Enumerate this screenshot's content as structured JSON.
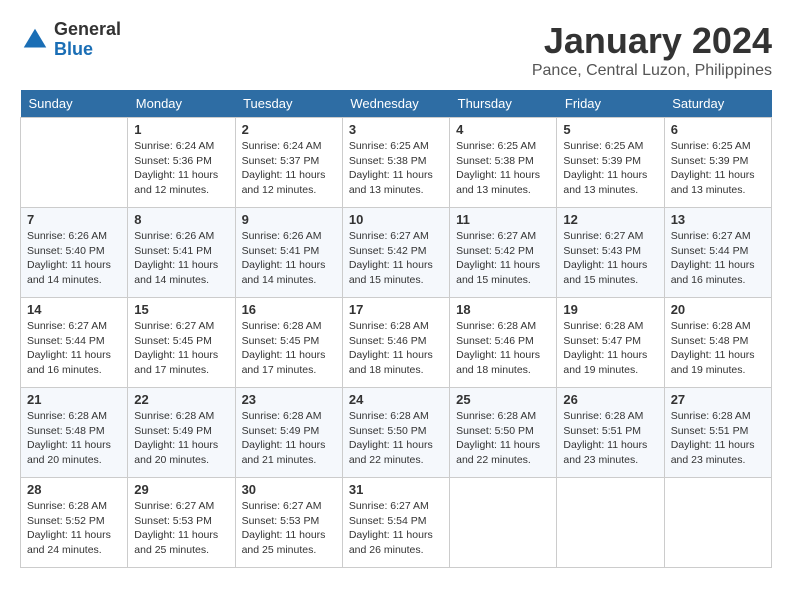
{
  "logo": {
    "general": "General",
    "blue": "Blue"
  },
  "title": "January 2024",
  "subtitle": "Pance, Central Luzon, Philippines",
  "days_of_week": [
    "Sunday",
    "Monday",
    "Tuesday",
    "Wednesday",
    "Thursday",
    "Friday",
    "Saturday"
  ],
  "weeks": [
    [
      {
        "day": "",
        "info": ""
      },
      {
        "day": "1",
        "info": "Sunrise: 6:24 AM\nSunset: 5:36 PM\nDaylight: 11 hours\nand 12 minutes."
      },
      {
        "day": "2",
        "info": "Sunrise: 6:24 AM\nSunset: 5:37 PM\nDaylight: 11 hours\nand 12 minutes."
      },
      {
        "day": "3",
        "info": "Sunrise: 6:25 AM\nSunset: 5:38 PM\nDaylight: 11 hours\nand 13 minutes."
      },
      {
        "day": "4",
        "info": "Sunrise: 6:25 AM\nSunset: 5:38 PM\nDaylight: 11 hours\nand 13 minutes."
      },
      {
        "day": "5",
        "info": "Sunrise: 6:25 AM\nSunset: 5:39 PM\nDaylight: 11 hours\nand 13 minutes."
      },
      {
        "day": "6",
        "info": "Sunrise: 6:25 AM\nSunset: 5:39 PM\nDaylight: 11 hours\nand 13 minutes."
      }
    ],
    [
      {
        "day": "7",
        "info": "Sunrise: 6:26 AM\nSunset: 5:40 PM\nDaylight: 11 hours\nand 14 minutes."
      },
      {
        "day": "8",
        "info": "Sunrise: 6:26 AM\nSunset: 5:41 PM\nDaylight: 11 hours\nand 14 minutes."
      },
      {
        "day": "9",
        "info": "Sunrise: 6:26 AM\nSunset: 5:41 PM\nDaylight: 11 hours\nand 14 minutes."
      },
      {
        "day": "10",
        "info": "Sunrise: 6:27 AM\nSunset: 5:42 PM\nDaylight: 11 hours\nand 15 minutes."
      },
      {
        "day": "11",
        "info": "Sunrise: 6:27 AM\nSunset: 5:42 PM\nDaylight: 11 hours\nand 15 minutes."
      },
      {
        "day": "12",
        "info": "Sunrise: 6:27 AM\nSunset: 5:43 PM\nDaylight: 11 hours\nand 15 minutes."
      },
      {
        "day": "13",
        "info": "Sunrise: 6:27 AM\nSunset: 5:44 PM\nDaylight: 11 hours\nand 16 minutes."
      }
    ],
    [
      {
        "day": "14",
        "info": "Sunrise: 6:27 AM\nSunset: 5:44 PM\nDaylight: 11 hours\nand 16 minutes."
      },
      {
        "day": "15",
        "info": "Sunrise: 6:27 AM\nSunset: 5:45 PM\nDaylight: 11 hours\nand 17 minutes."
      },
      {
        "day": "16",
        "info": "Sunrise: 6:28 AM\nSunset: 5:45 PM\nDaylight: 11 hours\nand 17 minutes."
      },
      {
        "day": "17",
        "info": "Sunrise: 6:28 AM\nSunset: 5:46 PM\nDaylight: 11 hours\nand 18 minutes."
      },
      {
        "day": "18",
        "info": "Sunrise: 6:28 AM\nSunset: 5:46 PM\nDaylight: 11 hours\nand 18 minutes."
      },
      {
        "day": "19",
        "info": "Sunrise: 6:28 AM\nSunset: 5:47 PM\nDaylight: 11 hours\nand 19 minutes."
      },
      {
        "day": "20",
        "info": "Sunrise: 6:28 AM\nSunset: 5:48 PM\nDaylight: 11 hours\nand 19 minutes."
      }
    ],
    [
      {
        "day": "21",
        "info": "Sunrise: 6:28 AM\nSunset: 5:48 PM\nDaylight: 11 hours\nand 20 minutes."
      },
      {
        "day": "22",
        "info": "Sunrise: 6:28 AM\nSunset: 5:49 PM\nDaylight: 11 hours\nand 20 minutes."
      },
      {
        "day": "23",
        "info": "Sunrise: 6:28 AM\nSunset: 5:49 PM\nDaylight: 11 hours\nand 21 minutes."
      },
      {
        "day": "24",
        "info": "Sunrise: 6:28 AM\nSunset: 5:50 PM\nDaylight: 11 hours\nand 22 minutes."
      },
      {
        "day": "25",
        "info": "Sunrise: 6:28 AM\nSunset: 5:50 PM\nDaylight: 11 hours\nand 22 minutes."
      },
      {
        "day": "26",
        "info": "Sunrise: 6:28 AM\nSunset: 5:51 PM\nDaylight: 11 hours\nand 23 minutes."
      },
      {
        "day": "27",
        "info": "Sunrise: 6:28 AM\nSunset: 5:51 PM\nDaylight: 11 hours\nand 23 minutes."
      }
    ],
    [
      {
        "day": "28",
        "info": "Sunrise: 6:28 AM\nSunset: 5:52 PM\nDaylight: 11 hours\nand 24 minutes."
      },
      {
        "day": "29",
        "info": "Sunrise: 6:27 AM\nSunset: 5:53 PM\nDaylight: 11 hours\nand 25 minutes."
      },
      {
        "day": "30",
        "info": "Sunrise: 6:27 AM\nSunset: 5:53 PM\nDaylight: 11 hours\nand 25 minutes."
      },
      {
        "day": "31",
        "info": "Sunrise: 6:27 AM\nSunset: 5:54 PM\nDaylight: 11 hours\nand 26 minutes."
      },
      {
        "day": "",
        "info": ""
      },
      {
        "day": "",
        "info": ""
      },
      {
        "day": "",
        "info": ""
      }
    ]
  ]
}
